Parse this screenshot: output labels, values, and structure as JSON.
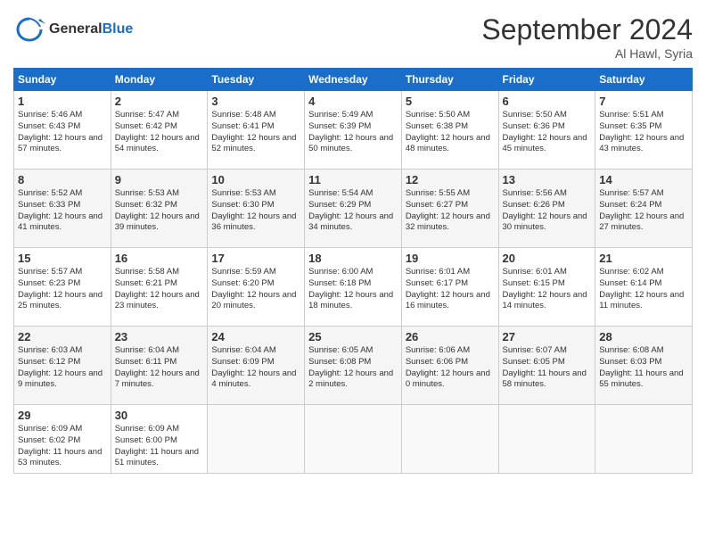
{
  "logo": {
    "line1": "General",
    "line2": "Blue"
  },
  "title": "September 2024",
  "subtitle": "Al Hawl, Syria",
  "days_header": [
    "Sunday",
    "Monday",
    "Tuesday",
    "Wednesday",
    "Thursday",
    "Friday",
    "Saturday"
  ],
  "weeks": [
    [
      {
        "day": "1",
        "sunrise": "Sunrise: 5:46 AM",
        "sunset": "Sunset: 6:43 PM",
        "daylight": "Daylight: 12 hours and 57 minutes."
      },
      {
        "day": "2",
        "sunrise": "Sunrise: 5:47 AM",
        "sunset": "Sunset: 6:42 PM",
        "daylight": "Daylight: 12 hours and 54 minutes."
      },
      {
        "day": "3",
        "sunrise": "Sunrise: 5:48 AM",
        "sunset": "Sunset: 6:41 PM",
        "daylight": "Daylight: 12 hours and 52 minutes."
      },
      {
        "day": "4",
        "sunrise": "Sunrise: 5:49 AM",
        "sunset": "Sunset: 6:39 PM",
        "daylight": "Daylight: 12 hours and 50 minutes."
      },
      {
        "day": "5",
        "sunrise": "Sunrise: 5:50 AM",
        "sunset": "Sunset: 6:38 PM",
        "daylight": "Daylight: 12 hours and 48 minutes."
      },
      {
        "day": "6",
        "sunrise": "Sunrise: 5:50 AM",
        "sunset": "Sunset: 6:36 PM",
        "daylight": "Daylight: 12 hours and 45 minutes."
      },
      {
        "day": "7",
        "sunrise": "Sunrise: 5:51 AM",
        "sunset": "Sunset: 6:35 PM",
        "daylight": "Daylight: 12 hours and 43 minutes."
      }
    ],
    [
      {
        "day": "8",
        "sunrise": "Sunrise: 5:52 AM",
        "sunset": "Sunset: 6:33 PM",
        "daylight": "Daylight: 12 hours and 41 minutes."
      },
      {
        "day": "9",
        "sunrise": "Sunrise: 5:53 AM",
        "sunset": "Sunset: 6:32 PM",
        "daylight": "Daylight: 12 hours and 39 minutes."
      },
      {
        "day": "10",
        "sunrise": "Sunrise: 5:53 AM",
        "sunset": "Sunset: 6:30 PM",
        "daylight": "Daylight: 12 hours and 36 minutes."
      },
      {
        "day": "11",
        "sunrise": "Sunrise: 5:54 AM",
        "sunset": "Sunset: 6:29 PM",
        "daylight": "Daylight: 12 hours and 34 minutes."
      },
      {
        "day": "12",
        "sunrise": "Sunrise: 5:55 AM",
        "sunset": "Sunset: 6:27 PM",
        "daylight": "Daylight: 12 hours and 32 minutes."
      },
      {
        "day": "13",
        "sunrise": "Sunrise: 5:56 AM",
        "sunset": "Sunset: 6:26 PM",
        "daylight": "Daylight: 12 hours and 30 minutes."
      },
      {
        "day": "14",
        "sunrise": "Sunrise: 5:57 AM",
        "sunset": "Sunset: 6:24 PM",
        "daylight": "Daylight: 12 hours and 27 minutes."
      }
    ],
    [
      {
        "day": "15",
        "sunrise": "Sunrise: 5:57 AM",
        "sunset": "Sunset: 6:23 PM",
        "daylight": "Daylight: 12 hours and 25 minutes."
      },
      {
        "day": "16",
        "sunrise": "Sunrise: 5:58 AM",
        "sunset": "Sunset: 6:21 PM",
        "daylight": "Daylight: 12 hours and 23 minutes."
      },
      {
        "day": "17",
        "sunrise": "Sunrise: 5:59 AM",
        "sunset": "Sunset: 6:20 PM",
        "daylight": "Daylight: 12 hours and 20 minutes."
      },
      {
        "day": "18",
        "sunrise": "Sunrise: 6:00 AM",
        "sunset": "Sunset: 6:18 PM",
        "daylight": "Daylight: 12 hours and 18 minutes."
      },
      {
        "day": "19",
        "sunrise": "Sunrise: 6:01 AM",
        "sunset": "Sunset: 6:17 PM",
        "daylight": "Daylight: 12 hours and 16 minutes."
      },
      {
        "day": "20",
        "sunrise": "Sunrise: 6:01 AM",
        "sunset": "Sunset: 6:15 PM",
        "daylight": "Daylight: 12 hours and 14 minutes."
      },
      {
        "day": "21",
        "sunrise": "Sunrise: 6:02 AM",
        "sunset": "Sunset: 6:14 PM",
        "daylight": "Daylight: 12 hours and 11 minutes."
      }
    ],
    [
      {
        "day": "22",
        "sunrise": "Sunrise: 6:03 AM",
        "sunset": "Sunset: 6:12 PM",
        "daylight": "Daylight: 12 hours and 9 minutes."
      },
      {
        "day": "23",
        "sunrise": "Sunrise: 6:04 AM",
        "sunset": "Sunset: 6:11 PM",
        "daylight": "Daylight: 12 hours and 7 minutes."
      },
      {
        "day": "24",
        "sunrise": "Sunrise: 6:04 AM",
        "sunset": "Sunset: 6:09 PM",
        "daylight": "Daylight: 12 hours and 4 minutes."
      },
      {
        "day": "25",
        "sunrise": "Sunrise: 6:05 AM",
        "sunset": "Sunset: 6:08 PM",
        "daylight": "Daylight: 12 hours and 2 minutes."
      },
      {
        "day": "26",
        "sunrise": "Sunrise: 6:06 AM",
        "sunset": "Sunset: 6:06 PM",
        "daylight": "Daylight: 12 hours and 0 minutes."
      },
      {
        "day": "27",
        "sunrise": "Sunrise: 6:07 AM",
        "sunset": "Sunset: 6:05 PM",
        "daylight": "Daylight: 11 hours and 58 minutes."
      },
      {
        "day": "28",
        "sunrise": "Sunrise: 6:08 AM",
        "sunset": "Sunset: 6:03 PM",
        "daylight": "Daylight: 11 hours and 55 minutes."
      }
    ],
    [
      {
        "day": "29",
        "sunrise": "Sunrise: 6:09 AM",
        "sunset": "Sunset: 6:02 PM",
        "daylight": "Daylight: 11 hours and 53 minutes."
      },
      {
        "day": "30",
        "sunrise": "Sunrise: 6:09 AM",
        "sunset": "Sunset: 6:00 PM",
        "daylight": "Daylight: 11 hours and 51 minutes."
      },
      null,
      null,
      null,
      null,
      null
    ]
  ]
}
